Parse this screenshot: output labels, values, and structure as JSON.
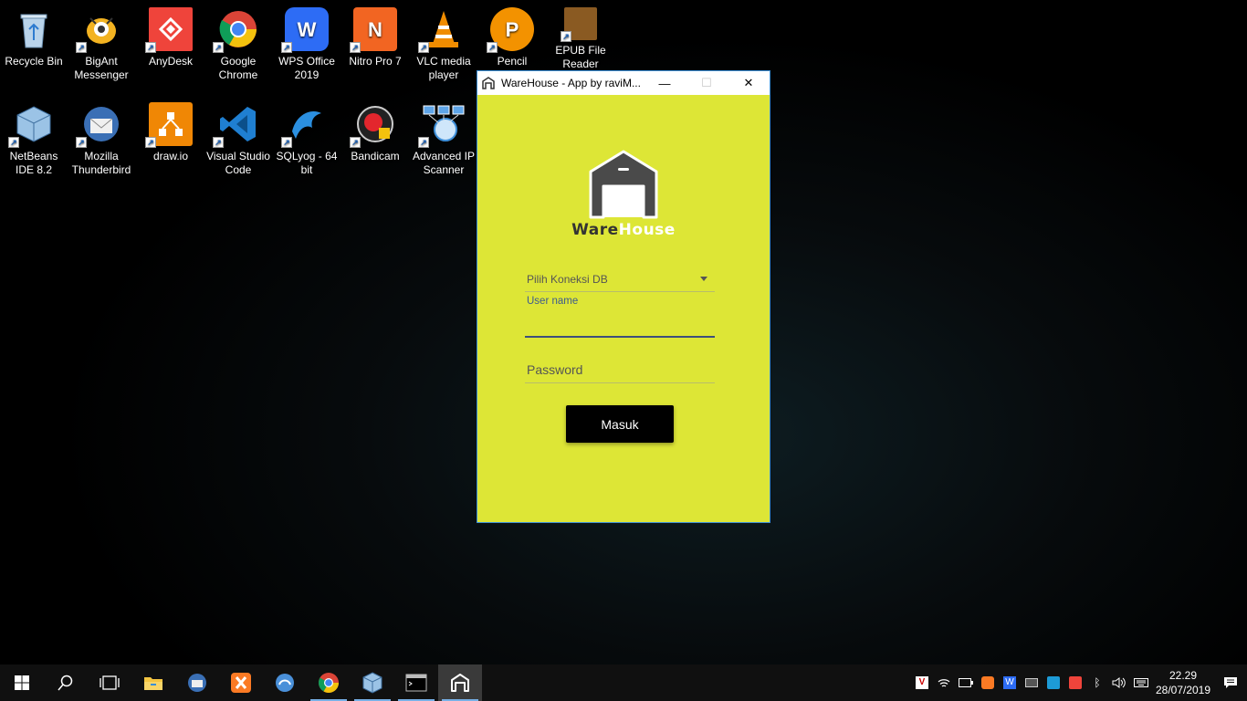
{
  "desktop": {
    "icons": [
      {
        "label": "Recycle Bin",
        "color": "#7ca6c9",
        "glyph": "🗑"
      },
      {
        "label": "BigAnt Messenger",
        "color": "#f3b321",
        "glyph": "●"
      },
      {
        "label": "AnyDesk",
        "color": "#ef443b",
        "glyph": "◆"
      },
      {
        "label": "Google Chrome",
        "color": "#4285f4",
        "glyph": "◉"
      },
      {
        "label": "WPS Office 2019",
        "color": "#2d6cf5",
        "glyph": "W"
      },
      {
        "label": "Nitro Pro 7",
        "color": "#f26522",
        "glyph": "N"
      },
      {
        "label": "VLC media player",
        "color": "#f08c00",
        "glyph": "▲"
      },
      {
        "label": "Pencil",
        "color": "#f39200",
        "glyph": "P"
      },
      {
        "label": "EPUB File Reader",
        "color": "#8a5a22",
        "glyph": "▮"
      },
      {
        "label": "NetBeans IDE 8.2",
        "color": "#9bc3e6",
        "glyph": "■"
      },
      {
        "label": "Mozilla Thunderbird",
        "color": "#3a6fb5",
        "glyph": "✉"
      },
      {
        "label": "draw.io",
        "color": "#f08705",
        "glyph": "⧉"
      },
      {
        "label": "Visual Studio Code",
        "color": "#1f7fd1",
        "glyph": "❮"
      },
      {
        "label": "SQLyog - 64 bit",
        "color": "#2b8fe0",
        "glyph": "🐬"
      },
      {
        "label": "Bandicam",
        "color": "#e3262d",
        "glyph": "●"
      },
      {
        "label": "Advanced IP Scanner",
        "color": "#5fa5e8",
        "glyph": "⚙"
      }
    ]
  },
  "window": {
    "title": "WareHouse - App by raviM...",
    "minimize": "—",
    "maximize": "☐",
    "close": "✕",
    "logo_ware": "Ware",
    "logo_house": "House",
    "db_select": "Pilih Koneksi DB",
    "username_label": "User name",
    "username_value": "",
    "password_placeholder": "Password",
    "login_button": "Masuk",
    "bg_color": "#dde636"
  },
  "taskbar": {
    "apps": [
      {
        "name": "start",
        "running": false,
        "active": false
      },
      {
        "name": "search",
        "running": false,
        "active": false
      },
      {
        "name": "task-view",
        "running": false,
        "active": false
      },
      {
        "name": "file-explorer",
        "running": false,
        "active": false
      },
      {
        "name": "thunderbird",
        "running": false,
        "active": false
      },
      {
        "name": "xampp",
        "running": false,
        "active": false
      },
      {
        "name": "edge-like-browser",
        "running": false,
        "active": false
      },
      {
        "name": "chrome",
        "running": true,
        "active": false
      },
      {
        "name": "netbeans",
        "running": true,
        "active": false
      },
      {
        "name": "command-prompt",
        "running": true,
        "active": false
      },
      {
        "name": "warehouse-app",
        "running": true,
        "active": true
      }
    ],
    "clock_time": "22.29",
    "clock_date": "28/07/2019"
  }
}
